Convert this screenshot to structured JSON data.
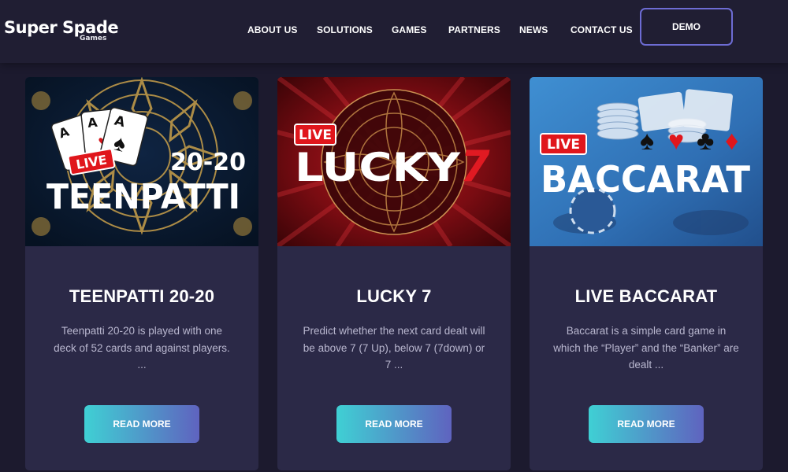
{
  "header": {
    "logo": {
      "main": "Super Spade",
      "sub": "Games"
    },
    "nav": [
      {
        "label": "ABOUT US"
      },
      {
        "label": "SOLUTIONS"
      },
      {
        "label": "GAMES"
      },
      {
        "label": "PARTNERS"
      },
      {
        "label": "NEWS"
      },
      {
        "label": "CONTACT US"
      }
    ],
    "demo_label": "DEMO"
  },
  "cards": [
    {
      "title": "TEENPATTI 20-20",
      "description": "Teenpatti 20-20 is played with one deck of 52 cards and against players. ...",
      "button_label": "READ MORE",
      "image": {
        "badge": "LIVE",
        "line1": "20-20",
        "line2": "TEENPATTI",
        "card_rank": "A"
      }
    },
    {
      "title": "LUCKY 7",
      "description": "Predict whether the next card dealt will be above 7 (7 Up), below 7 (7down) or 7 ...",
      "button_label": "READ MORE",
      "image": {
        "badge": "LIVE",
        "line1": "LUCKY",
        "line2": "7"
      }
    },
    {
      "title": "LIVE BACCARAT",
      "description": "Baccarat is a simple card game in which the “Player” and the “Banker” are dealt ...",
      "button_label": "READ MORE",
      "image": {
        "badge": "LIVE",
        "line1": "BACCARAT",
        "suits": "♠♥♣♦"
      }
    }
  ],
  "colors": {
    "page_bg": "#1c1a2e",
    "header_bg": "#201e33",
    "card_bg": "#2b2947",
    "demo_border": "#6d6cd4",
    "button_gradient_start": "#3fd0d4",
    "button_gradient_end": "#5f63bf",
    "live_badge": "#e0161c"
  }
}
